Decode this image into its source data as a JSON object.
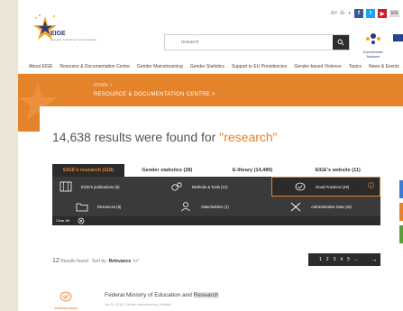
{
  "header": {
    "logo_text": "EIGE",
    "logo_sub": "European Institute for Gender Equality",
    "util_buttons": [
      "A+",
      "A-",
      "◐"
    ],
    "social": [
      {
        "name": "facebook",
        "label": "f",
        "color": "#3b5998"
      },
      {
        "name": "twitter",
        "label": "t",
        "color": "#1da1f2"
      },
      {
        "name": "youtube",
        "label": "▶",
        "color": "#cd201f"
      }
    ],
    "lang": "EN",
    "search": {
      "placeholder": "research",
      "value": "research"
    },
    "network_label": "EuroGender Network"
  },
  "nav": {
    "items": [
      "About EIGE",
      "Resource & Documentation Centre",
      "Gender Mainstreaming",
      "Gender Statistics",
      "Support to EU Presidencies",
      "Gender-based Violence",
      "Topics",
      "News & Events"
    ]
  },
  "hero": {
    "home": "HOME  >",
    "title": "RESOURCE & DOCUMENTATION CENTRE  >"
  },
  "results": {
    "prefix": "14,638 results were found for ",
    "query": "\"research\""
  },
  "tabs": [
    {
      "label": "EIGE's research (118)",
      "active": true
    },
    {
      "label": "Gender statistics (28)",
      "active": false
    },
    {
      "label": "E-library (14,489)",
      "active": false
    },
    {
      "label": "EIGE's website (11)",
      "active": false
    }
  ],
  "facets": [
    {
      "label": "EIGE's publications (8)",
      "icon": "publications-icon"
    },
    {
      "label": "Methods & Tools (12)",
      "icon": "gears-icon"
    },
    {
      "label": "Good Practices (49)",
      "icon": "check-badge-icon",
      "selected": true
    },
    {
      "label": "Resources (8)",
      "icon": "folder-icon"
    },
    {
      "label": "Stakeholders (1)",
      "icon": "stakeholder-icon"
    },
    {
      "label": "Administrative Data (16)",
      "icon": "tools-icon"
    }
  ],
  "clear": {
    "label": "Clear All"
  },
  "sort": {
    "count": "12",
    "found": " Results found",
    "sort_label": "Sort by: ",
    "sort_value": "Relevance"
  },
  "pager": {
    "pages": [
      "1",
      "2",
      "3",
      "4",
      "5",
      "..."
    ],
    "next": "→"
  },
  "result_items": [
    {
      "thumb_label": "GOOD PRACTICES",
      "title_pre": "Federal Ministry of Education and ",
      "title_hl": "Research",
      "meta": "Jun 10, 2016  |  Gender mainstreaming  |  Website"
    }
  ],
  "colors": {
    "accent": "#e5832a",
    "dark": "#2b2b2b",
    "grid": "#3a3a3a"
  }
}
